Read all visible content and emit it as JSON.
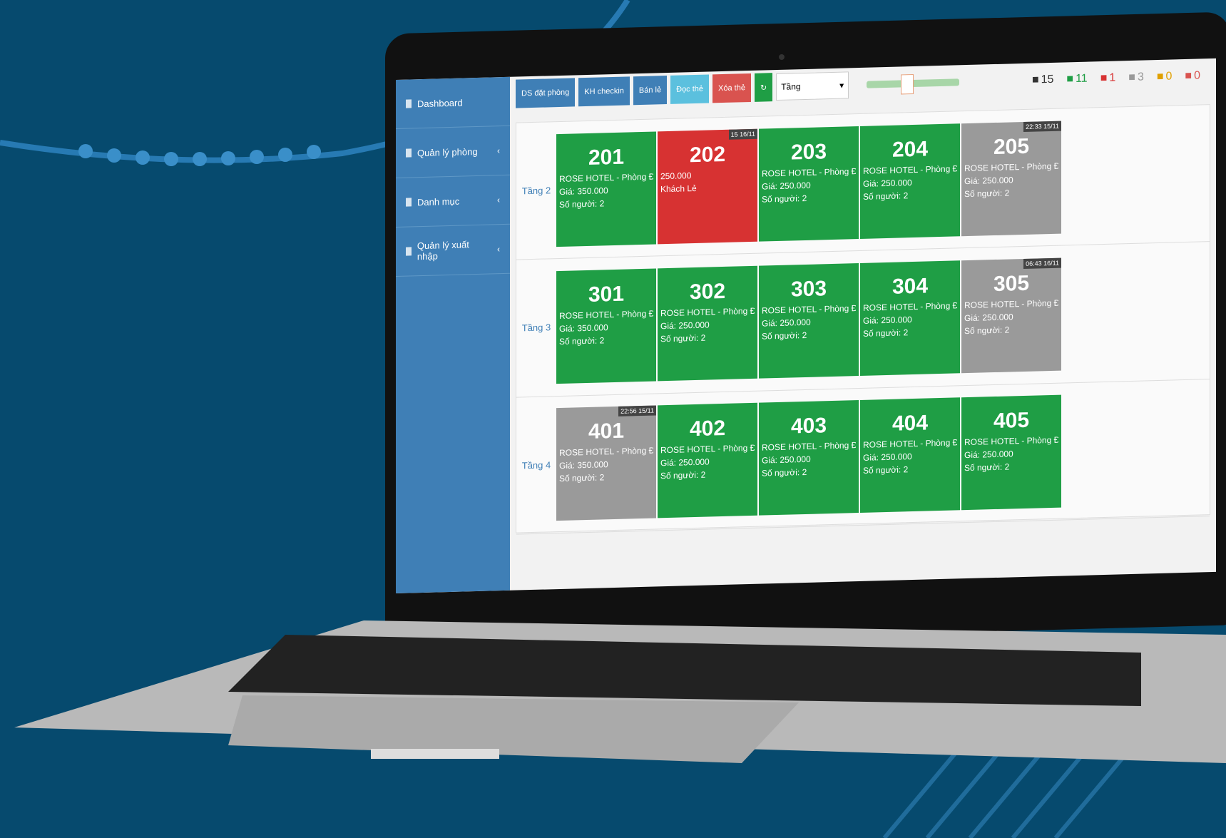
{
  "colors": {
    "background": "#064a6e",
    "sidebar": "#3f7fb6",
    "available": "#1f9e45",
    "occupied": "#d73232",
    "dirty": "#9a9a9a"
  },
  "sidebar": {
    "items": [
      {
        "label": "Dashboard",
        "icon": "dashboard-icon",
        "arrow": ""
      },
      {
        "label": "Quản lý phòng",
        "icon": "room-icon",
        "arrow": "‹"
      },
      {
        "label": "Danh mục",
        "icon": "catalog-icon",
        "arrow": "‹"
      },
      {
        "label": "Quản lý xuất nhập",
        "icon": "import-export-icon",
        "arrow": "‹"
      }
    ]
  },
  "toolbar": {
    "buttons": [
      {
        "label": "DS đặt phòng",
        "color": "#3f7fb6"
      },
      {
        "label": "KH checkin",
        "color": "#3f7fb6"
      },
      {
        "label": "Bán lẻ",
        "color": "#3f7fb6"
      },
      {
        "label": "Đọc thẻ",
        "color": "#5bc0de"
      },
      {
        "label": "Xóa thẻ",
        "color": "#d9534f"
      },
      {
        "label": "↻",
        "color": "#1f9e45"
      }
    ],
    "floor_select": "Tầng",
    "stats": [
      {
        "icon": "home-icon",
        "value": "15",
        "color": "#333"
      },
      {
        "icon": "available-room-icon",
        "value": "11",
        "color": "#1f9e45"
      },
      {
        "icon": "bed-icon",
        "value": "1",
        "color": "#d73232"
      },
      {
        "icon": "cleaning-icon",
        "value": "3",
        "color": "#999"
      },
      {
        "icon": "wrench-icon",
        "value": "0",
        "color": "#e0a000"
      },
      {
        "icon": "checkout-icon",
        "value": "0",
        "color": "#d9534f"
      }
    ]
  },
  "floors": [
    {
      "label": "Tầng 2",
      "rooms": [
        {
          "num": "201",
          "status": "green",
          "l1": "ROSE HOTEL - Phòng Đôi",
          "l2": "Giá: 350.000",
          "l3": "Số người: 2",
          "time": ""
        },
        {
          "num": "202",
          "status": "red",
          "l1": "250.000",
          "l2": "Khách Lẻ",
          "l3": "",
          "time": "15 16/11"
        },
        {
          "num": "203",
          "status": "green",
          "l1": "ROSE HOTEL - Phòng Đơn",
          "l2": "Giá: 250.000",
          "l3": "Số người: 2",
          "time": ""
        },
        {
          "num": "204",
          "status": "green",
          "l1": "ROSE HOTEL - Phòng Đơn",
          "l2": "Giá: 250.000",
          "l3": "Số người: 2",
          "time": ""
        },
        {
          "num": "205",
          "status": "gray",
          "l1": "ROSE HOTEL - Phòng Đơn",
          "l2": "Giá: 250.000",
          "l3": "Số người: 2",
          "time": "22:33 15/11"
        }
      ]
    },
    {
      "label": "Tầng 3",
      "rooms": [
        {
          "num": "301",
          "status": "green",
          "l1": "ROSE HOTEL - Phòng Đôi",
          "l2": "Giá: 350.000",
          "l3": "Số người: 2",
          "time": ""
        },
        {
          "num": "302",
          "status": "green",
          "l1": "ROSE HOTEL - Phòng Đơn",
          "l2": "Giá: 250.000",
          "l3": "Số người: 2",
          "time": ""
        },
        {
          "num": "303",
          "status": "green",
          "l1": "ROSE HOTEL - Phòng Đơn",
          "l2": "Giá: 250.000",
          "l3": "Số người: 2",
          "time": ""
        },
        {
          "num": "304",
          "status": "green",
          "l1": "ROSE HOTEL - Phòng Đơn",
          "l2": "Giá: 250.000",
          "l3": "Số người: 2",
          "time": ""
        },
        {
          "num": "305",
          "status": "gray",
          "l1": "ROSE HOTEL - Phòng Đơn",
          "l2": "Giá: 250.000",
          "l3": "Số người: 2",
          "time": "06:43 16/11"
        }
      ]
    },
    {
      "label": "Tầng 4",
      "rooms": [
        {
          "num": "401",
          "status": "gray",
          "l1": "ROSE HOTEL - Phòng Đôi",
          "l2": "Giá: 350.000",
          "l3": "Số người: 2",
          "time": "22:56 15/11"
        },
        {
          "num": "402",
          "status": "green",
          "l1": "ROSE HOTEL - Phòng Đơn",
          "l2": "Giá: 250.000",
          "l3": "Số người: 2",
          "time": ""
        },
        {
          "num": "403",
          "status": "green",
          "l1": "ROSE HOTEL - Phòng Đơn",
          "l2": "Giá: 250.000",
          "l3": "Số người: 2",
          "time": ""
        },
        {
          "num": "404",
          "status": "green",
          "l1": "ROSE HOTEL - Phòng Đơn",
          "l2": "Giá: 250.000",
          "l3": "Số người: 2",
          "time": ""
        },
        {
          "num": "405",
          "status": "green",
          "l1": "ROSE HOTEL - Phòng Đơn",
          "l2": "Giá: 250.000",
          "l3": "Số người: 2",
          "time": ""
        }
      ]
    }
  ]
}
